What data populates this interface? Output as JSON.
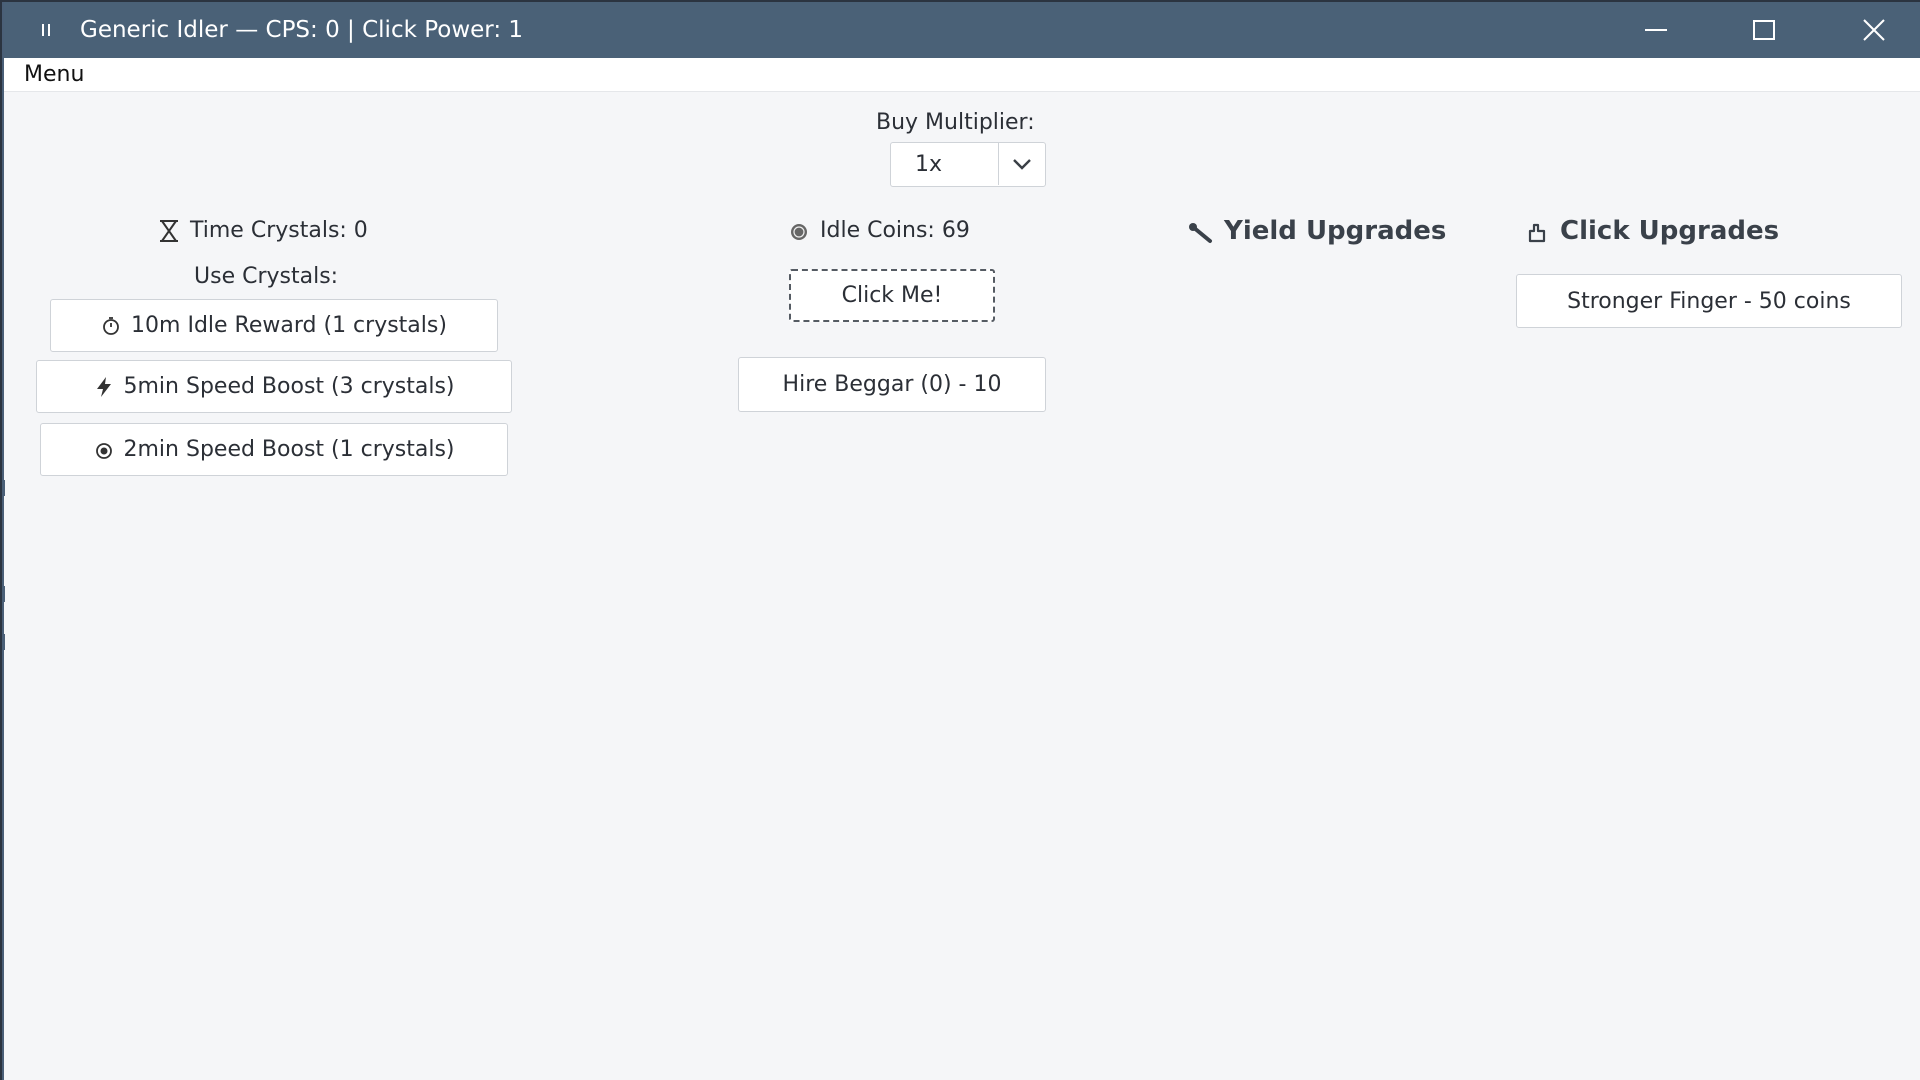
{
  "window": {
    "title": "Generic Idler — CPS: 0 | Click Power: 1",
    "app_icon": "pause-icon",
    "controls": [
      "minimize-icon",
      "maximize-icon",
      "close-icon"
    ]
  },
  "menubar": {
    "items": [
      {
        "label": "Menu"
      }
    ]
  },
  "buy_multiplier": {
    "label": "Buy Multiplier:",
    "selected": "1x"
  },
  "crystals": {
    "label": "Time Crystals: 0",
    "icon": "hourglass-icon",
    "use_label": "Use Crystals:",
    "actions": [
      {
        "label": "10m Idle Reward (1 crystals)",
        "icon": "stopwatch-icon"
      },
      {
        "label": "5min Speed Boost (3 crystals)",
        "icon": "lightning-icon"
      },
      {
        "label": "2min Speed Boost (1 crystals)",
        "icon": "snail-icon"
      }
    ]
  },
  "coins": {
    "label": "Idle Coins: 69",
    "icon": "coin-icon",
    "click_button": "Click Me!",
    "hire_button": "Hire Beggar (0) - 10"
  },
  "yield_upgrades": {
    "heading": "Yield Upgrades",
    "icon": "wrench-icon"
  },
  "click_upgrades": {
    "heading": "Click Upgrades",
    "icon": "pointing-hand-icon",
    "items": [
      {
        "label": "Stronger Finger - 50 coins"
      }
    ]
  },
  "colors": {
    "titlebar": "#4a6177",
    "background": "#f5f6f8",
    "button_border": "#cfd3d8",
    "text": "#2b2f36"
  }
}
